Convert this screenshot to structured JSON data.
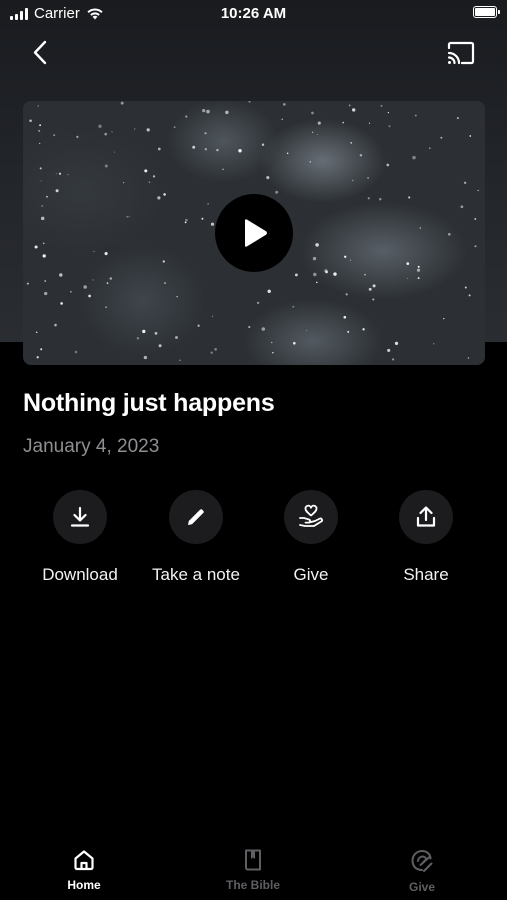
{
  "status_bar": {
    "carrier": "Carrier",
    "time": "10:26 AM"
  },
  "nav": {
    "back_icon": "chevron-left-icon",
    "cast_icon": "cast-icon"
  },
  "video": {
    "play_icon": "play-icon"
  },
  "content": {
    "title": "Nothing just happens",
    "date": "January 4, 2023"
  },
  "actions": [
    {
      "label": "Download",
      "icon": "download-icon"
    },
    {
      "label": "Take a note",
      "icon": "pencil-icon"
    },
    {
      "label": "Give",
      "icon": "hand-heart-icon"
    },
    {
      "label": "Share",
      "icon": "share-icon"
    }
  ],
  "tab_bar": {
    "tabs": [
      {
        "label": "Home",
        "icon": "home-icon",
        "active": true
      },
      {
        "label": "The Bible",
        "icon": "book-icon",
        "active": false
      },
      {
        "label": "Give",
        "icon": "give-icon",
        "active": false
      }
    ]
  },
  "colors": {
    "background": "#000000",
    "secondary_text": "#8e8e93",
    "action_circle": "#1c1c1e",
    "inactive_tab": "#5f5f63"
  }
}
